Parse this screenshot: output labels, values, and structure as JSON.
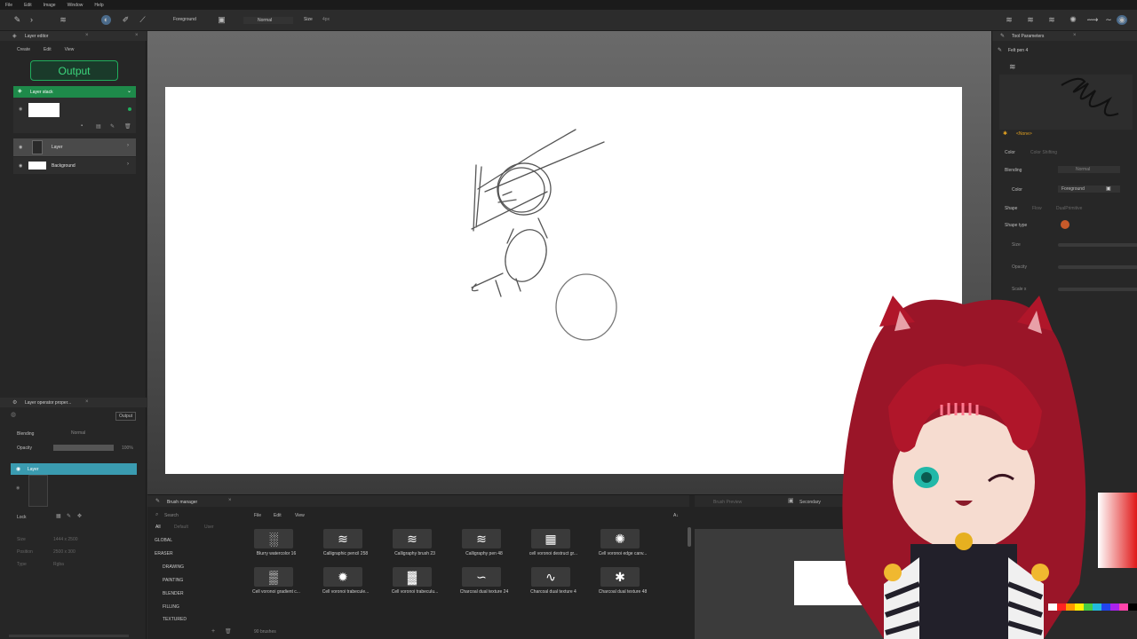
{
  "menubar": [
    "File",
    "Edit",
    "Image",
    "Window",
    "Help"
  ],
  "toolbar": {
    "foreground": "Foreground",
    "blend": "Normal",
    "size_label": "Size",
    "size_value": "4px"
  },
  "layer_editor": {
    "title": "Layer editor",
    "menu": [
      "Create",
      "Edit",
      "View"
    ],
    "output_button": "Output",
    "stack_title": "Layer stack",
    "layers": [
      "Layer",
      "Background"
    ]
  },
  "layer_operator": {
    "title": "Layer operator proper...",
    "output_chip": "Output",
    "blending_label": "Blending",
    "blending_value": "Normal",
    "opacity_label": "Opacity",
    "opacity_value": "100%",
    "opacity_fraction": 1.0,
    "layer_name": "Layer",
    "lock_label": "Lock",
    "size_label": "Size",
    "size_value": "1444 x 2500",
    "position_label": "Position",
    "position_value": "2500 x 300",
    "type_label": "Type",
    "type_value": "Rgba"
  },
  "tool_parameters": {
    "title": "Tool Parameters",
    "tool_name": "Felt pen 4",
    "none_label": "<None>",
    "color_tabs": [
      "Color",
      "Color Shifting"
    ],
    "blending_label": "Blending",
    "blending_value": "Normal",
    "color_label": "Color",
    "color_value": "Foreground",
    "shape_tabs": [
      "Shape",
      "Flow",
      "DualPrimitive"
    ],
    "shape_type_label": "Shape type",
    "size_label": "Size",
    "opacity_label": "Opacity",
    "scale_label": "Scale x"
  },
  "brush_manager": {
    "title": "Brush manager",
    "search_placeholder": "Search",
    "menu": [
      "File",
      "Edit",
      "View"
    ],
    "filter_tabs": [
      "All",
      "Default",
      "User"
    ],
    "categories": [
      "GLOBAL",
      "ERASER",
      "DRAWING",
      "PAINTING",
      "BLENDER",
      "FILLING",
      "TEXTURED"
    ],
    "brushes": [
      "Blurry watercolor 16",
      "Calligraphic pencil 258",
      "Calligraphy brush 23",
      "Calligraphy pen 48",
      "cell voronoi destruct gr...",
      "Cell voronoi edge canv...",
      "Cell voronoi gradient c...",
      "Cell voronoi trabecule...",
      "Cell voronoi trabeculu...",
      "Charcoal dual texture 24",
      "Charcoal dual texture 4",
      "Charcoal dual texture 48"
    ],
    "count": "90 brushes"
  },
  "brush_preview": {
    "title": "Brush Preview",
    "secondary": "Secondary"
  },
  "colors": {
    "accent_green": "#1e8a4a",
    "accent_teal": "#3a9bb0",
    "avatar_red": "#b0162a"
  }
}
